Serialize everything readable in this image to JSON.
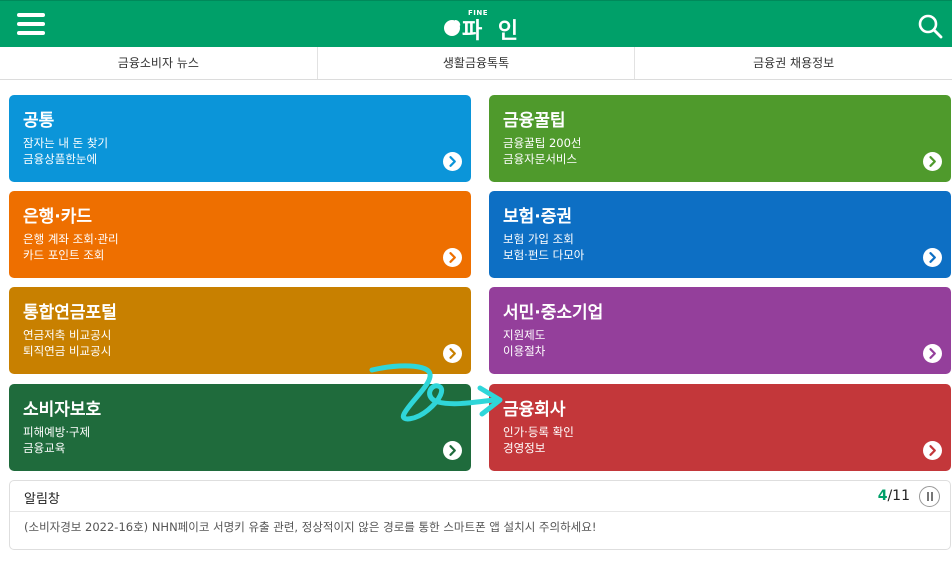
{
  "header": {
    "logo_small": "FINE",
    "logo_text": "파 인",
    "menu_icon": "hamburger-menu-icon",
    "search_icon": "search-icon",
    "brand_color": "#00a069"
  },
  "tabs": [
    {
      "label": "금융소비자 뉴스"
    },
    {
      "label": "생활금융톡톡"
    },
    {
      "label": "금융권 채용정보"
    }
  ],
  "tiles": [
    {
      "title": "공통",
      "line1": "잠자는 내 돈 찾기",
      "line2": "금융상품한눈에",
      "color": "#0b95d9"
    },
    {
      "title": "금융꿀팁",
      "line1": "금융꿀팁 200선",
      "line2": "금융자문서비스",
      "color": "#4f9a2c"
    },
    {
      "title": "은행·카드",
      "line1": "은행 계좌 조회·관리",
      "line2": "카드 포인트 조회",
      "color": "#ee6f00"
    },
    {
      "title": "보험·증권",
      "line1": "보험 가입 조회",
      "line2": "보험·펀드 다모아",
      "color": "#0d6fc4"
    },
    {
      "title": "통합연금포털",
      "line1": "연금저축 비교공시",
      "line2": "퇴직연금 비교공시",
      "color": "#c88000"
    },
    {
      "title": "서민·중소기업",
      "line1": "지원제도",
      "line2": "이용절차",
      "color": "#943f9b"
    },
    {
      "title": "소비자보호",
      "line1": "피해예방·구제",
      "line2": "금융교육",
      "color": "#1f6b3c"
    },
    {
      "title": "금융회사",
      "line1": "인가·등록 확인",
      "line2": "경영정보",
      "color": "#c3373a"
    }
  ],
  "tile_arrow_icon": "chevron-right-circle-icon",
  "annotation_color": "#2fd6d9",
  "notice": {
    "title": "알림창",
    "current": "4",
    "separator": "/",
    "total": "11",
    "pause_icon": "pause-icon",
    "text": "(소비자경보 2022-16호) NHN페이코 서명키 유출 관련, 정상적이지 않은 경로를 통한 스마트폰 앱 설치시 주의하세요!"
  }
}
